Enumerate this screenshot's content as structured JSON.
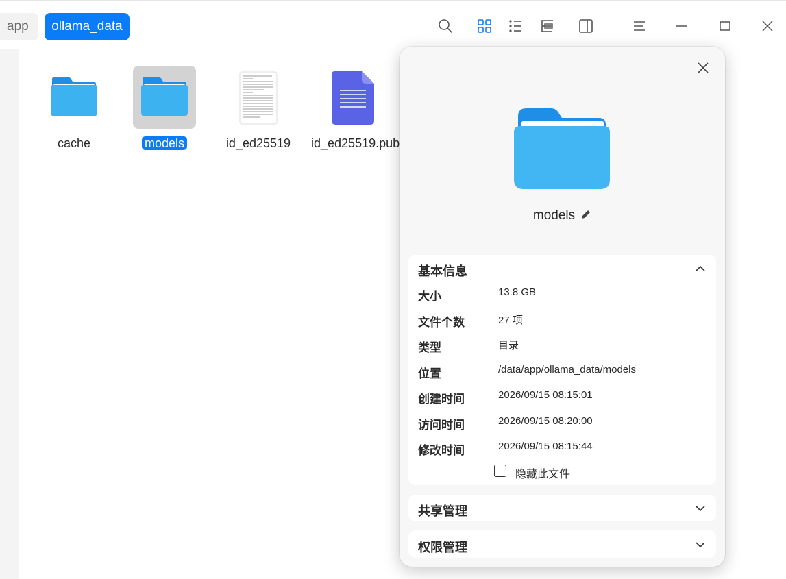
{
  "breadcrumb": {
    "items": [
      "app",
      "ollama_data"
    ]
  },
  "toolbar": {
    "icons": [
      "search-icon",
      "icon-view-icon",
      "list-view-icon",
      "tree-view-icon",
      "side-panel-icon",
      "menu-icon",
      "minimize-icon",
      "maximize-icon",
      "close-icon"
    ]
  },
  "files": [
    {
      "name": "cache",
      "type": "folder"
    },
    {
      "name": "models",
      "type": "folder",
      "selected": true
    },
    {
      "name": "id_ed25519",
      "type": "text-file"
    },
    {
      "name": "id_ed25519.pub",
      "type": "document-file"
    }
  ],
  "properties": {
    "name": "models",
    "basic": {
      "title": "基本信息",
      "rows": [
        {
          "label": "大小",
          "value": "13.8 GB"
        },
        {
          "label": "文件个数",
          "value": "27 项"
        },
        {
          "label": "类型",
          "value": "目录"
        },
        {
          "label": "位置",
          "value": "/data/app/ollama_data/models"
        },
        {
          "label": "创建时间",
          "value": "2026/09/15 08:15:01"
        },
        {
          "label": "访问时间",
          "value": "2026/09/15 08:20:00"
        },
        {
          "label": "修改时间",
          "value": "2026/09/15 08:15:44"
        }
      ],
      "hide_label": "隐藏此文件"
    },
    "share": {
      "title": "共享管理"
    },
    "permission": {
      "title": "权限管理"
    }
  },
  "colors": {
    "accent": "#0a7cf7",
    "folder_light": "#5fd0f7",
    "folder_dark": "#1e8ee6",
    "doc": "#5a63e6"
  }
}
